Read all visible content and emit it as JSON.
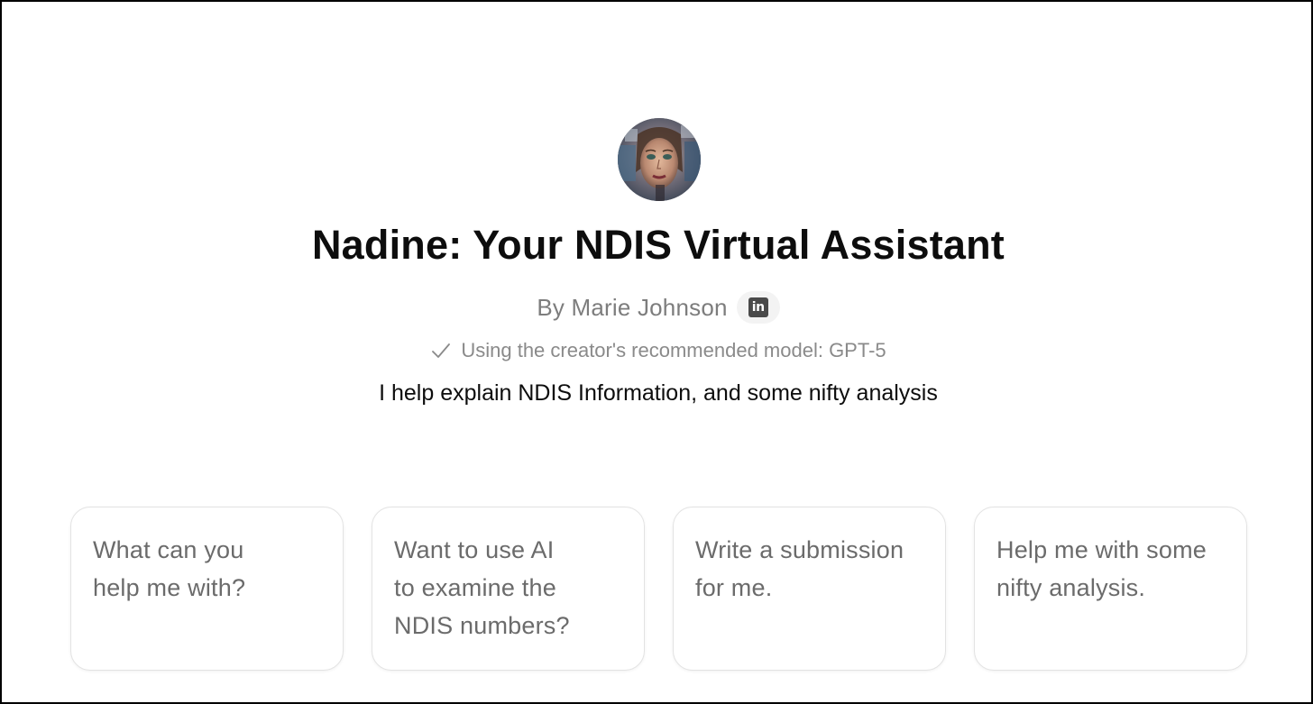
{
  "gpt": {
    "title": "Nadine: Your NDIS Virtual Assistant",
    "author": "By Marie Johnson",
    "author_social_icon": "linkedin-icon",
    "model_notice": "Using the creator's recommended model: GPT-5",
    "description": "I help explain NDIS Information, and some nifty analysis"
  },
  "conversation_starters": [
    {
      "text": "What can you\nhelp me with?"
    },
    {
      "text": "Want to use AI\nto examine the\nNDIS numbers?"
    },
    {
      "text": "Write a submission\nfor me."
    },
    {
      "text": "Help me with some\nnifty analysis."
    }
  ],
  "colors": {
    "title": "#0d0d0d",
    "muted_text": "#7d7d7d",
    "card_border": "#e3e3e3",
    "card_text": "#6b6b6b"
  }
}
